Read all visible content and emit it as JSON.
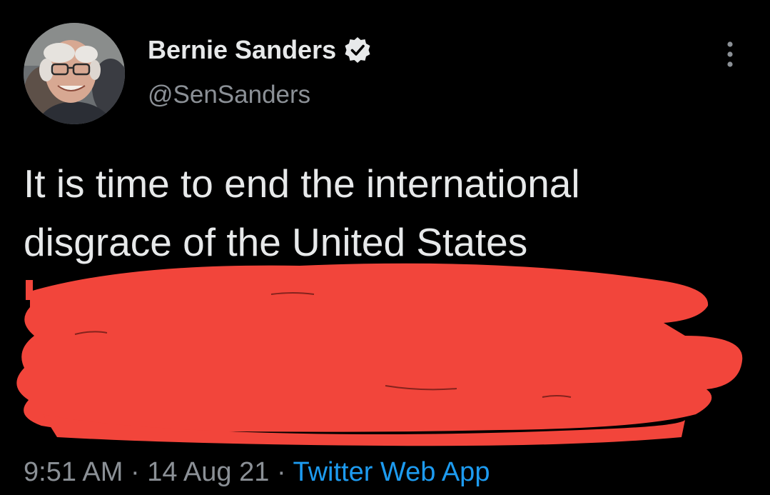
{
  "author": {
    "display_name": "Bernie Sanders",
    "handle": "@SenSanders",
    "verified": true,
    "avatar_icon": "profile-photo"
  },
  "tweet": {
    "lines": [
      "It is time to end the international",
      "disgrace of the United States"
    ]
  },
  "meta": {
    "time": "9:51 AM",
    "separator": "·",
    "date": "14 Aug 21",
    "source": "Twitter Web App"
  },
  "colors": {
    "background": "#000000",
    "text": "#e7e9ea",
    "secondary": "#8b9096",
    "link": "#1d9bf0",
    "redaction": "#f2453b"
  },
  "icons": {
    "verified": "verified-badge-icon",
    "more": "more-dots-icon"
  }
}
